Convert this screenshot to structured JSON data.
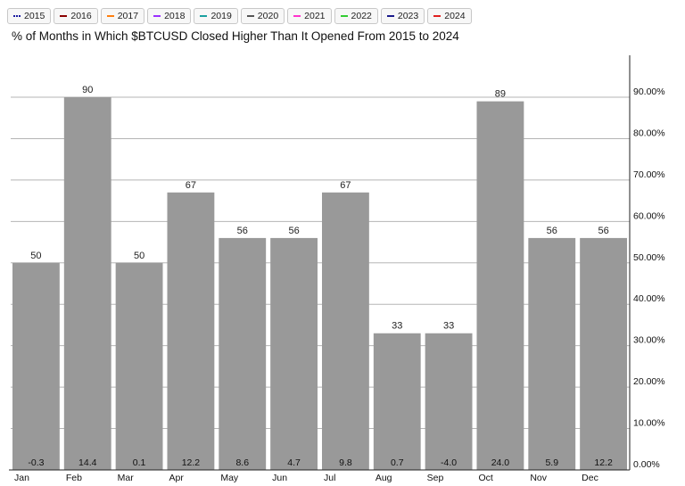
{
  "legend": [
    {
      "label": "2015",
      "color": "#1a1aa0",
      "style": "dotted"
    },
    {
      "label": "2016",
      "color": "#8b0000",
      "style": "solid"
    },
    {
      "label": "2017",
      "color": "#ff7f0e",
      "style": "solid"
    },
    {
      "label": "2018",
      "color": "#9b30ff",
      "style": "solid"
    },
    {
      "label": "2019",
      "color": "#1aa0a0",
      "style": "solid"
    },
    {
      "label": "2020",
      "color": "#555555",
      "style": "solid"
    },
    {
      "label": "2021",
      "color": "#ff33cc",
      "style": "solid"
    },
    {
      "label": "2022",
      "color": "#33cc33",
      "style": "solid"
    },
    {
      "label": "2023",
      "color": "#1a1a8b",
      "style": "solid"
    },
    {
      "label": "2024",
      "color": "#e02020",
      "style": "solid"
    }
  ],
  "chart_data": {
    "type": "bar",
    "title": "% of Months in Which $BTCUSD Closed Higher Than It Opened From 2015 to 2024",
    "categories": [
      "Jan",
      "Feb",
      "Mar",
      "Apr",
      "May",
      "Jun",
      "Jul",
      "Aug",
      "Sep",
      "Oct",
      "Nov",
      "Dec"
    ],
    "values": [
      50,
      90,
      50,
      67,
      56,
      56,
      67,
      33,
      33,
      89,
      56,
      56
    ],
    "bottom_labels": [
      "-0.3",
      "14.4",
      "0.1",
      "12.2",
      "8.6",
      "4.7",
      "9.8",
      "0.7",
      "-4.0",
      "24.0",
      "5.9",
      "12.2"
    ],
    "ylim": [
      0,
      100
    ],
    "yticks": [
      0,
      10,
      20,
      30,
      40,
      50,
      60,
      70,
      80,
      90
    ],
    "ytick_labels": [
      "0.00%",
      "10.00%",
      "20.00%",
      "30.00%",
      "40.00%",
      "50.00%",
      "60.00%",
      "70.00%",
      "80.00%",
      "90.00%"
    ],
    "y_axis_side": "right",
    "grid": true,
    "bar_color": "#999999",
    "xlabel": "",
    "ylabel": ""
  }
}
